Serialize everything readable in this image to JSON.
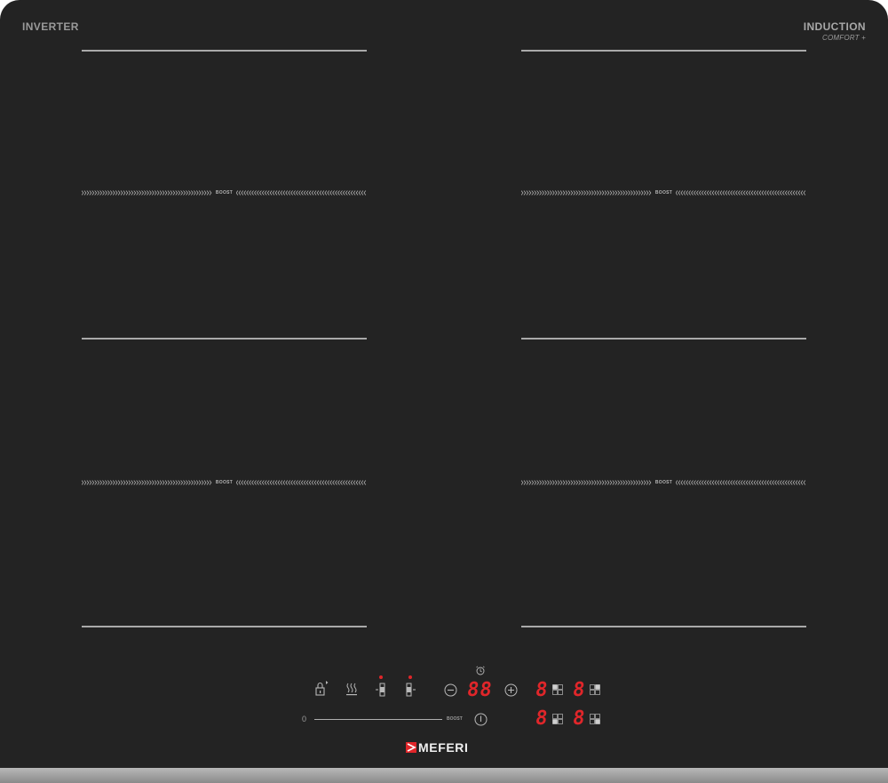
{
  "brand": {
    "left_label": "INVERTER",
    "right_label": "INDUCTION",
    "right_sub": "COMFORT +",
    "logo": "MEFERI"
  },
  "zones": {
    "boost_label": "BOOST"
  },
  "controls": {
    "lock_icon": "lock-icon",
    "keep_warm_icon": "keep-warm-icon",
    "timer_display": "88",
    "zone_displays": [
      "8",
      "8",
      "8",
      "8"
    ],
    "slider_min": "0",
    "slider_boost": "BOOST",
    "minus_icon": "minus-icon",
    "plus_icon": "plus-icon",
    "power_icon": "power-icon",
    "clock_icon": "alarm-clock-icon"
  },
  "colors": {
    "glass": "#232323",
    "led_red": "#e0262a",
    "line": "#a9a9a9"
  }
}
